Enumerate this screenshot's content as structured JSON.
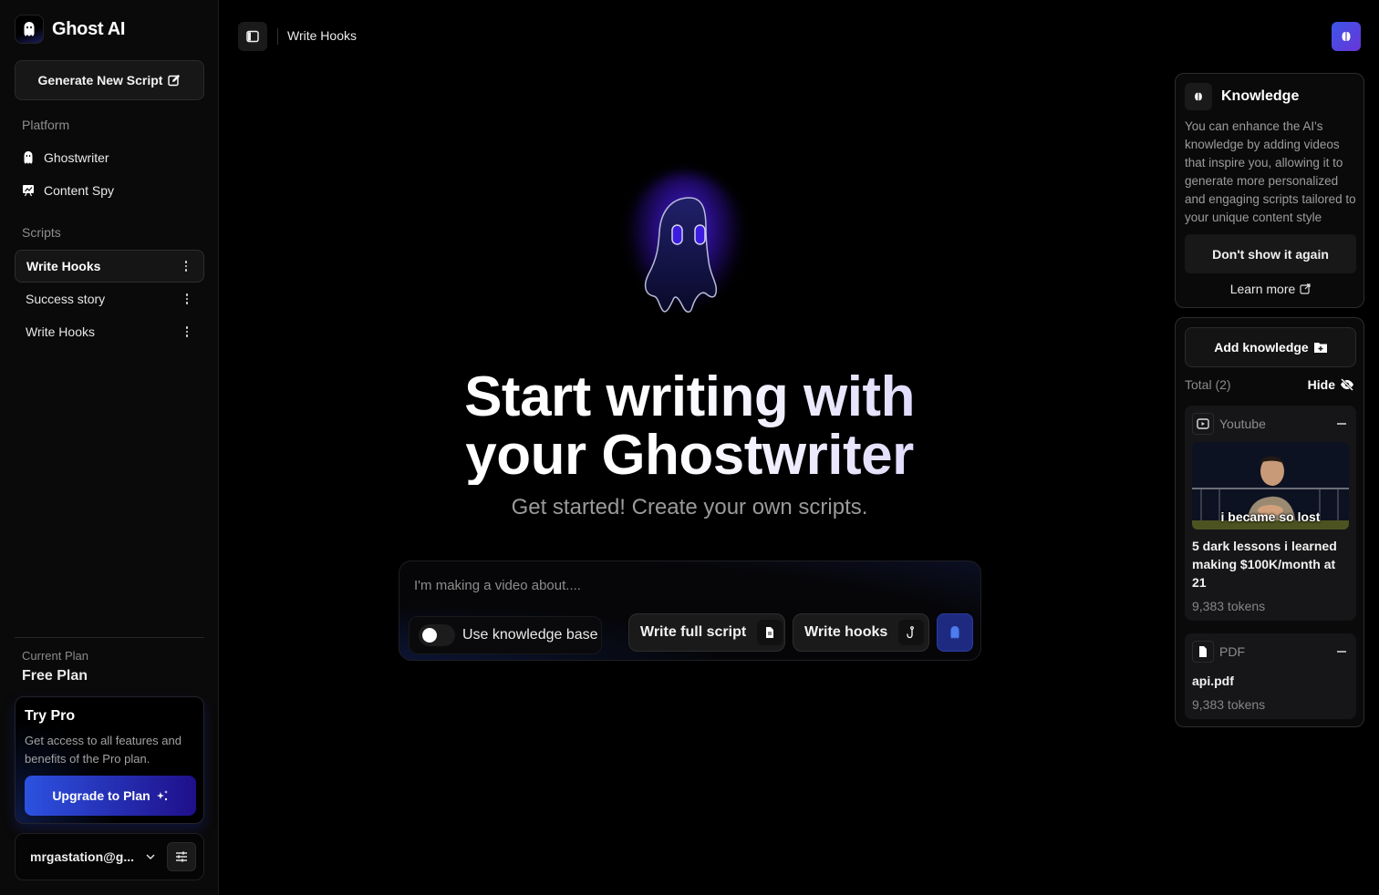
{
  "app": {
    "name": "Ghost AI"
  },
  "sidebar": {
    "generate_label": "Generate New Script",
    "platform_label": "Platform",
    "platform_items": [
      {
        "label": "Ghostwriter",
        "icon": "ghost-icon"
      },
      {
        "label": "Content Spy",
        "icon": "presentation-chart-icon"
      }
    ],
    "scripts_label": "Scripts",
    "scripts": [
      {
        "label": "Write Hooks",
        "active": true
      },
      {
        "label": "Success story",
        "active": false
      },
      {
        "label": "Write Hooks",
        "active": false
      }
    ],
    "plan": {
      "label": "Current Plan",
      "name": "Free Plan",
      "promo_title": "Try Pro",
      "promo_desc": "Get access to all features and benefits of the Pro plan.",
      "upgrade_label": "Upgrade to Plan"
    },
    "user": {
      "email": "mrgastation@g..."
    }
  },
  "header": {
    "breadcrumb": "Write Hooks"
  },
  "hero": {
    "title_line1": "Start writing with",
    "title_line2": "your Ghostwriter",
    "subtitle": "Get started! Create your own scripts."
  },
  "prompt": {
    "placeholder": "I'm making a video about....",
    "value": "",
    "kb_toggle_label": "Use knowledge base",
    "kb_toggle_on": false,
    "write_full_label": "Write full script",
    "write_hooks_label": "Write hooks"
  },
  "knowledge_card": {
    "title": "Knowledge",
    "description": "You can enhance the AI's knowledge by adding videos that inspire you, allowing it to generate more personalized and engaging scripts tailored to your unique content style",
    "dismiss_label": "Don't show it again",
    "learn_more_label": "Learn more"
  },
  "knowledge_panel": {
    "add_label": "Add knowledge",
    "total_label": "Total (2)",
    "hide_label": "Hide",
    "items": [
      {
        "type": "Youtube",
        "thumbnail_caption": "i became so lost",
        "title": "5 dark lessons i learned making $100K/month at 21",
        "tokens": "9,383 tokens"
      },
      {
        "type": "PDF",
        "title": "api.pdf",
        "tokens": "9,383 tokens"
      }
    ]
  },
  "colors": {
    "accent": "#3b56e8",
    "accent2": "#6a35d8",
    "glow": "#4a1fe0",
    "background": "#000000",
    "sidebar": "#0a0a0a"
  }
}
